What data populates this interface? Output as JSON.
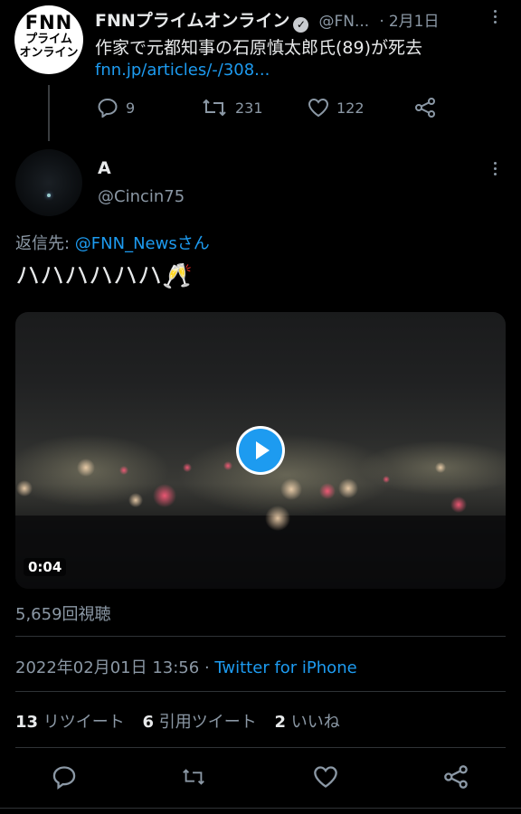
{
  "parent_tweet": {
    "display_name": "FNNプライムオンライン",
    "handle": "@FN...",
    "separator": "·",
    "date": "2月1日",
    "avatar_text_line1": "FNN",
    "avatar_text_line2": "プライム",
    "avatar_text_line3": "オンライン",
    "text": "作家で元都知事の石原慎太郎氏(89)が死去",
    "link": "fnn.jp/articles/-/308...",
    "replies": "9",
    "retweets": "231",
    "likes": "122"
  },
  "reply_tweet": {
    "display_name": "A",
    "handle": "@Cincin75",
    "reply_to_prefix": "返信先: ",
    "reply_to_handle": "@FNN_News",
    "reply_to_suffix": "さん",
    "text": "ハハハハハハ🥂",
    "video_duration": "0:04",
    "view_count": "5,659回視聴",
    "timestamp": "2022年02月01日 13:56",
    "dot": " · ",
    "source": "Twitter for iPhone",
    "retweet_count": "13",
    "retweet_label": "リツイート",
    "quote_count": "6",
    "quote_label": "引用ツイート",
    "like_count": "2",
    "like_label": "いいね"
  },
  "colors": {
    "background": "#000000",
    "text": "#e7e9ea",
    "muted": "#8b98a5",
    "link": "#1d9bf0",
    "divider": "#2f3336"
  },
  "icons": [
    "reply-icon",
    "retweet-icon",
    "like-icon",
    "share-icon",
    "verified-icon",
    "more-icon",
    "play-icon"
  ]
}
